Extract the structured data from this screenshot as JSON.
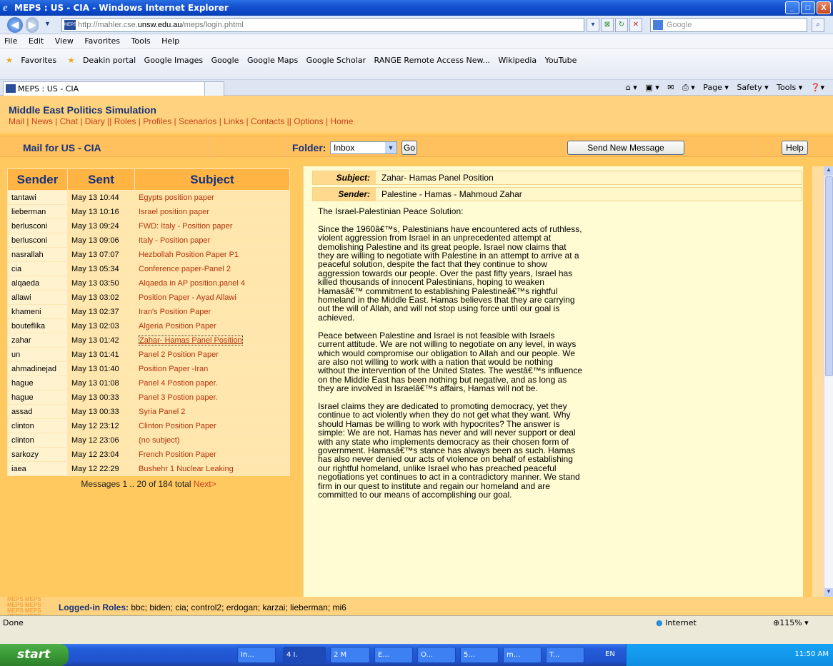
{
  "window": {
    "title": "MEPS : US - CIA - Windows Internet Explorer",
    "minimize": "_",
    "maximize": "□",
    "close": "X"
  },
  "addressbar": {
    "url_prefix": "http://mahler.cse.",
    "url_host": "unsw.edu.au",
    "url_path": "/meps/login.phtml",
    "search_placeholder": "Google"
  },
  "menu": [
    "File",
    "Edit",
    "View",
    "Favorites",
    "Tools",
    "Help"
  ],
  "favorites": {
    "label": "Favorites",
    "links": [
      "Deakin portal",
      "Google Images",
      "Google",
      "Google Maps",
      "Google Scholar",
      "RANGE Remote Access New...",
      "Wikipedia",
      "YouTube"
    ]
  },
  "tab": {
    "label": "MEPS : US - CIA"
  },
  "commandbar": [
    "Page ▾",
    "Safety ▾",
    "Tools ▾"
  ],
  "site": {
    "title": "Middle East Politics Simulation",
    "nav": [
      {
        "label": "Mail",
        "sep": " | "
      },
      {
        "label": "News",
        "sep": " | "
      },
      {
        "label": "Chat",
        "sep": " | "
      },
      {
        "label": "Diary",
        "sep": " || "
      },
      {
        "label": "Roles",
        "sep": " | "
      },
      {
        "label": "Profiles",
        "sep": " | "
      },
      {
        "label": "Scenarios",
        "sep": " | "
      },
      {
        "label": "Links",
        "sep": " | "
      },
      {
        "label": "Contacts",
        "sep": " || "
      },
      {
        "label": "Options",
        "sep": " | "
      },
      {
        "label": "Home",
        "sep": ""
      }
    ]
  },
  "mailbar": {
    "mail_for": "Mail for US - CIA",
    "folder_label": "Folder:",
    "folder_value": "Inbox",
    "go": "Go",
    "send_new": "Send New Message",
    "help": "Help"
  },
  "list": {
    "headers": {
      "sender": "Sender",
      "sent": "Sent",
      "subject": "Subject"
    },
    "rows": [
      {
        "sender": "tantawi",
        "sent": "May 13 10:44",
        "subject": "Egypts position paper"
      },
      {
        "sender": "lieberman",
        "sent": "May 13 10:16",
        "subject": "Israel position paper"
      },
      {
        "sender": "berlusconi",
        "sent": "May 13 09:24",
        "subject": "FWD: Italy - Position paper"
      },
      {
        "sender": "berlusconi",
        "sent": "May 13 09:06",
        "subject": "Italy - Position paper"
      },
      {
        "sender": "nasrallah",
        "sent": "May 13 07:07",
        "subject": "Hezbollah Position Paper P1"
      },
      {
        "sender": "cia",
        "sent": "May 13 05:34",
        "subject": "Conference paper-Panel 2"
      },
      {
        "sender": "alqaeda",
        "sent": "May 13 03:50",
        "subject": "Alqaeda in AP position.panel 4"
      },
      {
        "sender": "allawi",
        "sent": "May 13 03:02",
        "subject": "Position Paper - Ayad Allawi"
      },
      {
        "sender": "khameni",
        "sent": "May 13 02:37",
        "subject": "Iran's Position Paper"
      },
      {
        "sender": "bouteflika",
        "sent": "May 13 02:03",
        "subject": "Algeria Position Paper"
      },
      {
        "sender": "zahar",
        "sent": "May 13 01:42",
        "subject": "Zahar- Hamas Panel Position"
      },
      {
        "sender": "un",
        "sent": "May 13 01:41",
        "subject": "Panel 2 Position Paper"
      },
      {
        "sender": "ahmadinejad",
        "sent": "May 13 01:40",
        "subject": "Position Paper -Iran"
      },
      {
        "sender": "hague",
        "sent": "May 13 01:08",
        "subject": "Panel 4 Postion paper."
      },
      {
        "sender": "hague",
        "sent": "May 13 00:33",
        "subject": "Panel 3 Postion paper."
      },
      {
        "sender": "assad",
        "sent": "May 13 00:33",
        "subject": "Syria Panel 2"
      },
      {
        "sender": "clinton",
        "sent": "May 12 23:12",
        "subject": "Clinton Position Paper"
      },
      {
        "sender": "clinton",
        "sent": "May 12 23:06",
        "subject": "(no subject)"
      },
      {
        "sender": "sarkozy",
        "sent": "May 12 23:04",
        "subject": "French Position Paper"
      },
      {
        "sender": "iaea",
        "sent": "May 12 22:29",
        "subject": "Bushehr 1 Nuclear Leaking"
      }
    ],
    "pager_text": "Messages 1 .. 20 of 184 total",
    "pager_next": "Next>"
  },
  "message": {
    "subject_label": "Subject:",
    "subject": "Zahar- Hamas Panel Position",
    "sender_label": "Sender:",
    "sender": "Palestine - Hamas - Mahmoud Zahar",
    "body": "The Israel-Palestinian Peace Solution:\n\nSince the 1960â€™s, Palestinians have encountered acts of ruthless, violent aggression from Israel in an unprecedented attempt at demolishing Palestine and its great people. Israel now claims that they are willing to negotiate with Palestine in an attempt to arrive at a peaceful solution, despite the fact that they continue to show aggression towards our people. Over the past fifty years, Israel has killed thousands of innocent Palestinians, hoping to weaken Hamasâ€™ commitment to establishing Palestineâ€™s rightful homeland in the Middle East. Hamas believes that they are carrying out the will of Allah, and will not stop using force until our goal is achieved.\n\nPeace between Palestine and Israel is not feasible with Israels current attitude. We are not willing to negotiate on any level, in ways which would compromise our obligation to Allah and our people. We are also not willing to work with a nation that would be nothing without the intervention of the United States. The westâ€™s influence on the Middle East has been nothing but negative, and as long as they are involved in Israelâ€™s affairs, Hamas will not be.\n\nIsrael claims they are dedicated to promoting democracy, yet they continue to act violently when they do not get what they want. Why should Hamas be willing to work with hypocrites? The answer is simple: We are not. Hamas has never and will never support or deal with any state who implements democracy as their chosen form of government. Hamasâ€™s stance has always been as such. Hamas has also never denied our acts of violence on behalf of establishing our rightful homeland, unlike Israel who has preached peaceful negotiations yet continues to act in a contradictory manner. We stand firm in our quest to institute and regain our homeland and are committed to our means of accomplishing our goal."
  },
  "footer": {
    "logo_text": "MEPS MEPS",
    "roles_label": "Logged-in Roles:",
    "roles": "bbc; biden; cia; control2; erdogan; karzai; lieberman; mi6"
  },
  "statusbar": {
    "status": "Done",
    "zone": "Internet",
    "zoom": "115%"
  },
  "taskbar": {
    "start": "start",
    "items": [
      "In...",
      "4 I.",
      "2 M",
      "E...",
      "O...",
      "5...",
      "m...",
      "T..."
    ],
    "lang": "EN",
    "clock": "11:50 AM"
  }
}
